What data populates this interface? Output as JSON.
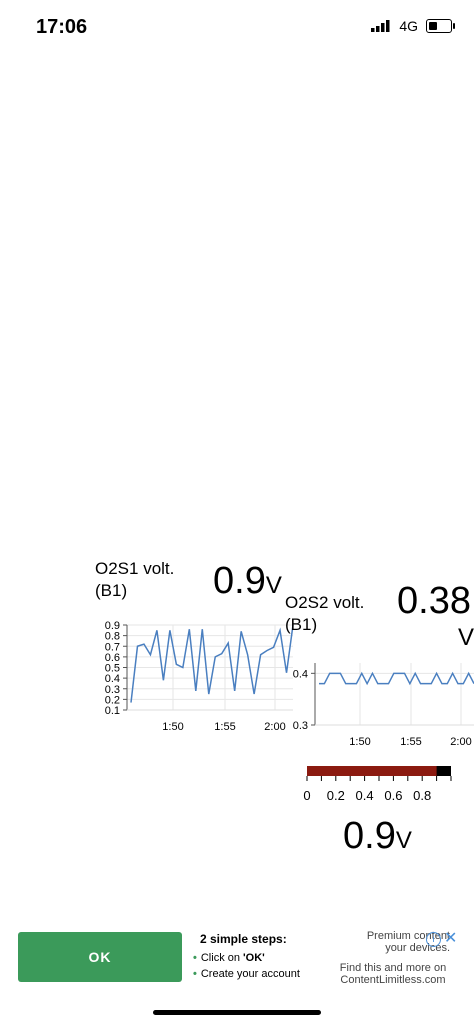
{
  "status": {
    "time": "17:06",
    "network": "4G"
  },
  "gauges": [
    {
      "label_line1": "O2S1 volt.",
      "label_line2": "(B1)",
      "value": "0.9",
      "unit": "V"
    },
    {
      "label_line1": "O2S2 volt.",
      "label_line2": "(B1)",
      "value": "0.38",
      "unit": "V"
    },
    {
      "value": "0.9",
      "unit": "V"
    }
  ],
  "chart_data": [
    {
      "type": "line",
      "title": "O2S1 volt. (B1)",
      "x_ticks": [
        "1:50",
        "1:55",
        "2:00"
      ],
      "y_ticks": [
        "0.9",
        "0.8",
        "0.7",
        "0.6",
        "0.5",
        "0.4",
        "0.3",
        "0.2",
        "0.1"
      ],
      "ylim": [
        0.1,
        0.9
      ],
      "grid": true,
      "values": [
        0.17,
        0.7,
        0.72,
        0.62,
        0.85,
        0.38,
        0.85,
        0.53,
        0.5,
        0.86,
        0.28,
        0.86,
        0.25,
        0.6,
        0.63,
        0.73,
        0.28,
        0.84,
        0.62,
        0.25,
        0.62,
        0.66,
        0.69,
        0.85,
        0.45,
        0.9
      ]
    },
    {
      "type": "line",
      "title": "O2S2 volt. (B1)",
      "x_ticks": [
        "1:50",
        "1:55",
        "2:00"
      ],
      "y_ticks": [
        "0.4",
        "0.3"
      ],
      "ylim": [
        0.3,
        0.42
      ],
      "grid": true,
      "values": [
        0.38,
        0.38,
        0.4,
        0.4,
        0.4,
        0.38,
        0.38,
        0.38,
        0.4,
        0.38,
        0.4,
        0.38,
        0.38,
        0.38,
        0.4,
        0.4,
        0.4,
        0.38,
        0.4,
        0.38,
        0.38,
        0.38,
        0.4,
        0.38,
        0.38,
        0.4,
        0.38,
        0.38,
        0.4,
        0.38
      ]
    },
    {
      "type": "bar",
      "orientation": "horizontal",
      "x_ticks": [
        "0",
        "0.2",
        "0.4",
        "0.6",
        "0.8"
      ],
      "xlim": [
        0,
        1
      ],
      "value": 0.9,
      "colors": {
        "fill": "#8b1a10",
        "background": "#000000"
      }
    }
  ],
  "ad": {
    "ok_label": "OK",
    "steps_title": "2 simple steps:",
    "step1_prefix": "Click on ",
    "step1_bold": "'OK'",
    "step2": "Create your account",
    "premium_line1": "Premium content",
    "premium_line2": "your devices.",
    "find_line1": "Find this and more on",
    "find_line2": "ContentLimitless.com",
    "accent": "#3b9a5a"
  }
}
